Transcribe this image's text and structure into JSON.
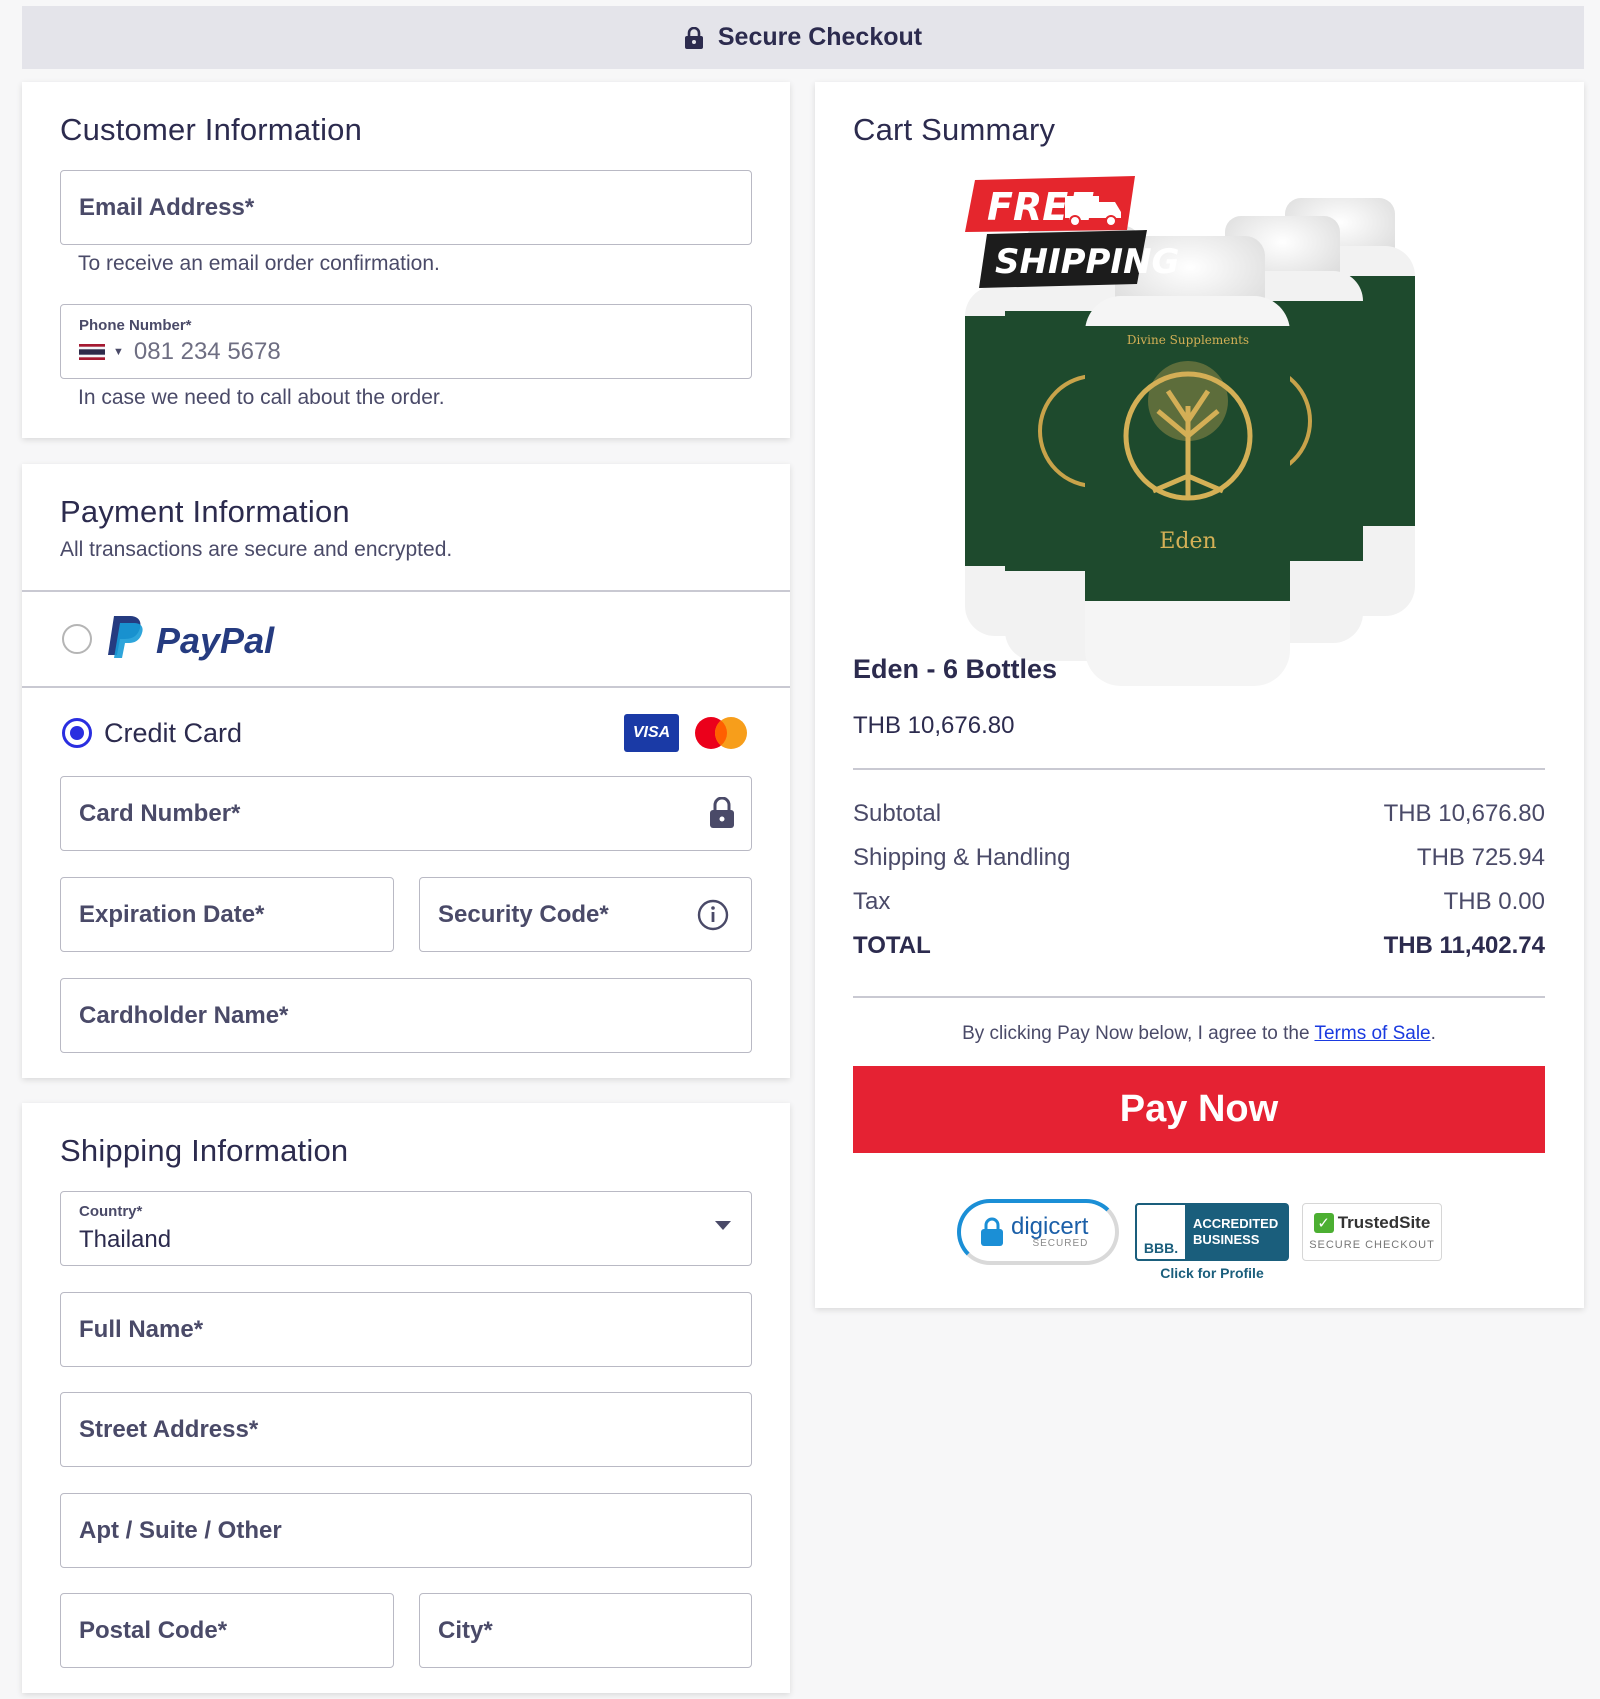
{
  "header": {
    "title": "Secure Checkout",
    "icon": "lock-icon"
  },
  "customer": {
    "title": "Customer Information",
    "email_label": "Email Address*",
    "email_hint": "To receive an email order confirmation.",
    "phone_label": "Phone Number*",
    "phone_placeholder": "081 234 5678",
    "phone_hint": "In case we need to call about the order."
  },
  "payment": {
    "title": "Payment Information",
    "subtitle": "All transactions are secure and encrypted.",
    "paypal_label": "PayPal",
    "paypal_selected": false,
    "credit_label": "Credit Card",
    "credit_selected": true,
    "visa_label": "VISA",
    "card_number_label": "Card Number*",
    "expiration_label": "Expiration Date*",
    "security_label": "Security Code*",
    "cardholder_label": "Cardholder Name*"
  },
  "shipping": {
    "title": "Shipping Information",
    "country_label": "Country*",
    "country_value": "Thailand",
    "full_name_label": "Full Name*",
    "street_label": "Street Address*",
    "apt_label": "Apt / Suite / Other",
    "postal_label": "Postal Code*",
    "city_label": "City*"
  },
  "cart": {
    "title": "Cart Summary",
    "badge_line1": "FREE",
    "badge_line2": "SHIPPING",
    "bottle_brand": "Divine Supplements",
    "bottle_name": "Eden",
    "product_name": "Eden - 6 Bottles",
    "product_price": "THB 10,676.80",
    "subtotal_label": "Subtotal",
    "subtotal_value": "THB 10,676.80",
    "shipping_label": "Shipping & Handling",
    "shipping_value": "THB 725.94",
    "tax_label": "Tax",
    "tax_value": "THB 0.00",
    "total_label": "TOTAL",
    "total_value": "THB 11,402.74",
    "terms_prefix": "By clicking Pay Now below, I agree to the ",
    "terms_link": "Terms of Sale",
    "terms_suffix": ".",
    "pay_button": "Pay Now"
  },
  "badges": {
    "digicert_name": "digicert",
    "digicert_sub": "SECURED",
    "bbb_line1": "ACCREDITED",
    "bbb_line2": "BUSINESS",
    "bbb_mark": "BBB.",
    "bbb_caption": "Click for Profile",
    "trusted_name": "TrustedSite",
    "trusted_sub": "SECURE CHECKOUT"
  },
  "colors": {
    "accent_blue": "#2a2ee0",
    "pay_red": "#e52233",
    "text_dark": "#2c2b4e",
    "bottle_green": "#1e4a2d"
  }
}
